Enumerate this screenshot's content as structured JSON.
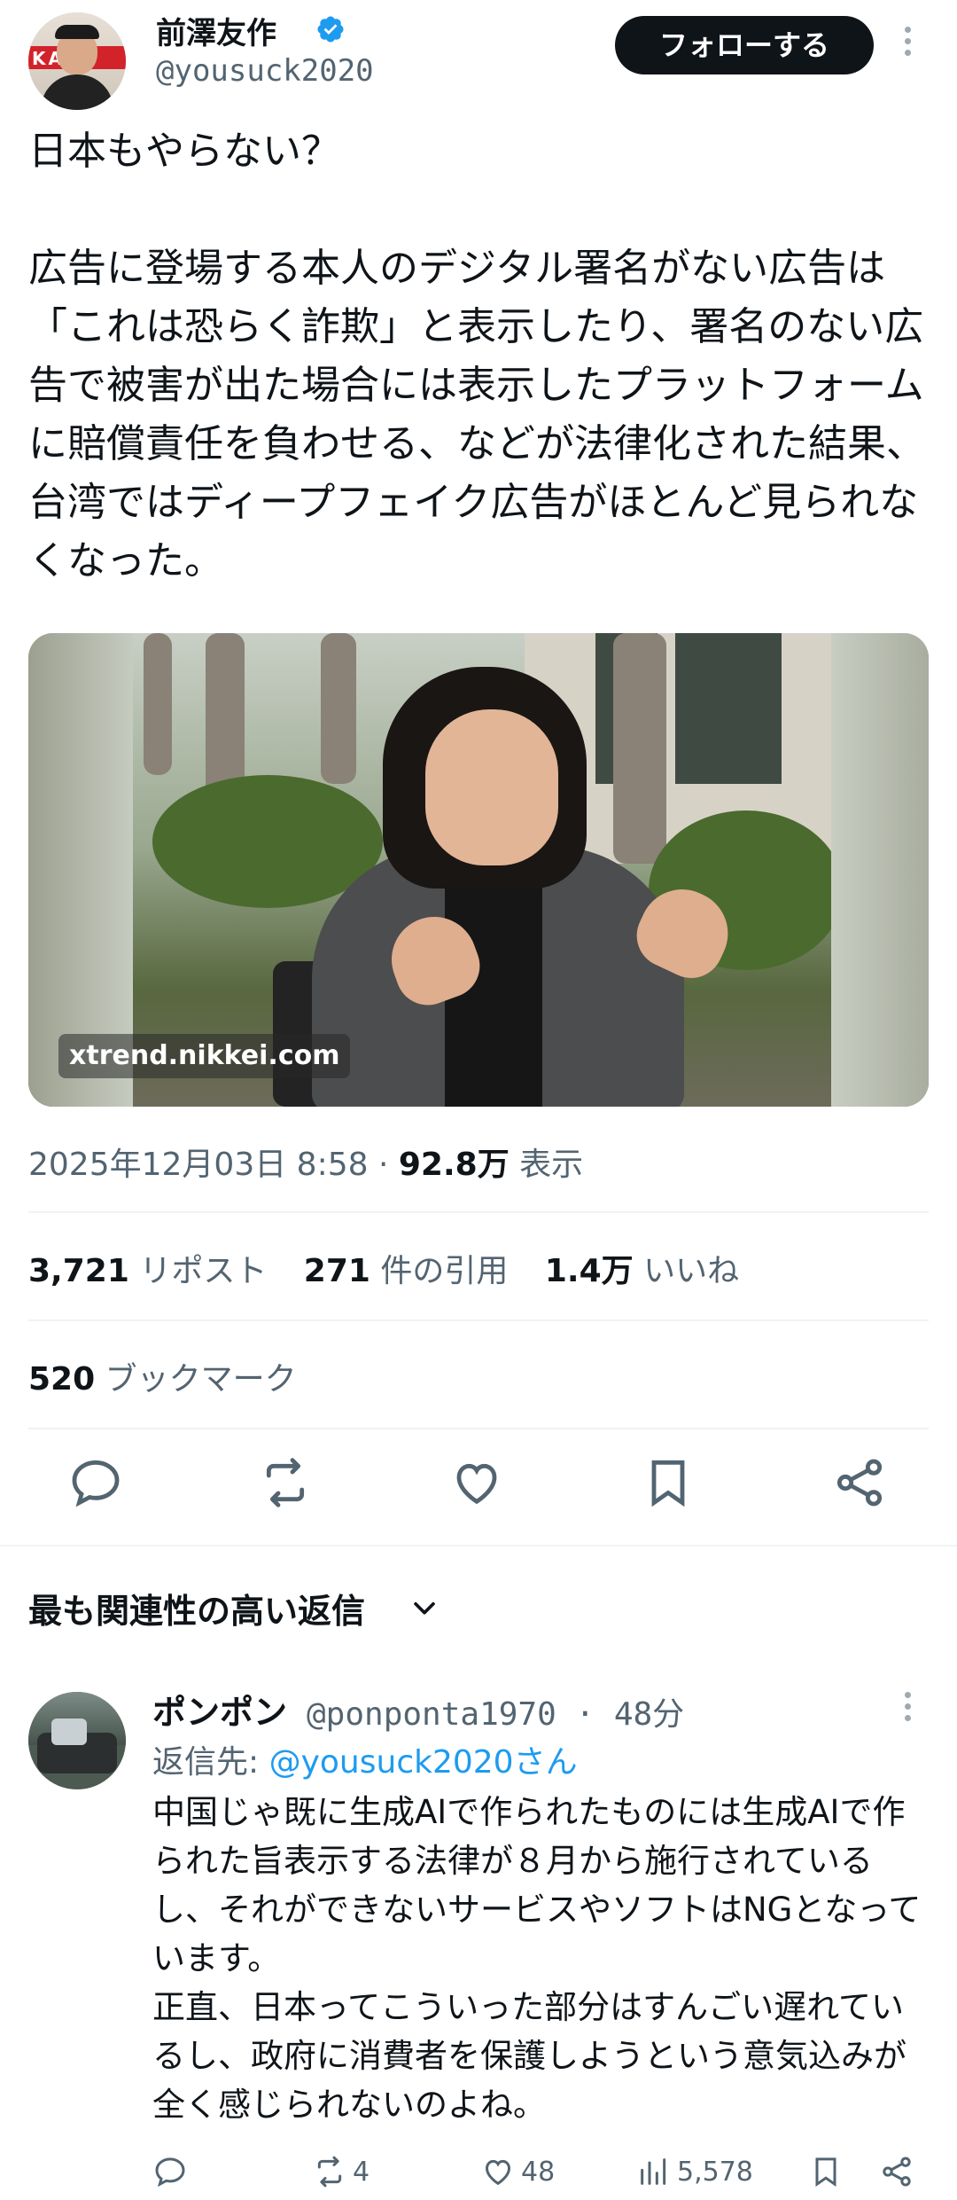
{
  "author": {
    "name": "前澤友作",
    "handle": "@yousuck2020",
    "verified": true,
    "avatar_band_text": "KA  &",
    "follow_label": "フォローする"
  },
  "tweet": {
    "text": "日本もやらない？\n\n広告に登場する本人のデジタル署名がない広告は「これは恐らく詐欺」と表示したり、署名のない広告で被害が出た場合には表示したプラットフォームに賠償責任を負わせる、などが法律化された結果、台湾ではディープフェイク広告がほとんど見られなくなった。",
    "media_source": "xtrend.nikkei.com",
    "timestamp": "2025年12月03日 8:58",
    "views_count": "92.8万",
    "views_label": "表示"
  },
  "stats": {
    "reposts_count": "3,721",
    "reposts_label": "リポスト",
    "quotes_count": "271",
    "quotes_label": "件の引用",
    "likes_count": "1.4万",
    "likes_label": "いいね",
    "bookmarks_count": "520",
    "bookmarks_label": "ブックマーク"
  },
  "actions": {
    "icons": [
      "reply-icon",
      "repost-icon",
      "like-icon",
      "bookmark-icon",
      "share-icon"
    ]
  },
  "replies": {
    "header": "最も関連性の高い返信",
    "items": [
      {
        "name": "ポンポン",
        "handle": "@ponponta1970",
        "time": "48分",
        "reply_to_label": "返信先:",
        "reply_to_mention": "@yousuck2020さん",
        "text": "中国じゃ既に生成AIで作られたものには生成AIで作られた旨表示する法律が８月から施行されているし、それができないサービスやソフトはNGとなっています。\n正直、日本ってこういった部分はすんごい遅れているし、政府に消費者を保護しようという意気込みが全く感じられないのよね。",
        "reposts": "4",
        "likes": "48",
        "views": "5,578"
      }
    ]
  },
  "colors": {
    "text": "#0f1419",
    "secondary": "#536471",
    "accent": "#1d9bf0",
    "verified": "#1d9bf0",
    "follow_bg": "#0f1419"
  }
}
